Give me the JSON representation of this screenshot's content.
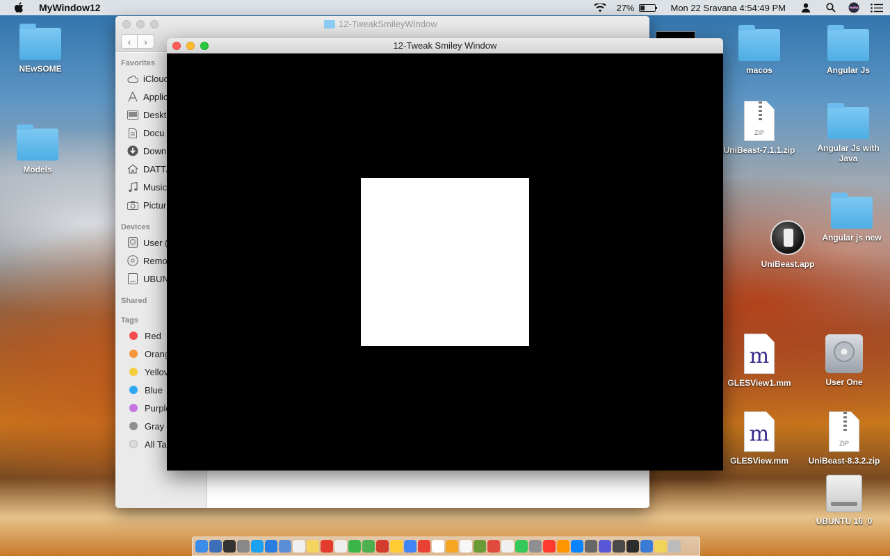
{
  "menubar": {
    "app_name": "MyWindow12",
    "battery_percent": "27%",
    "datetime": "Mon 22 Sravana  4:54:49 PM"
  },
  "desktop": {
    "left_icons": [
      {
        "label": "NEwSOME",
        "kind": "folder"
      },
      {
        "label": "Models",
        "kind": "folder"
      }
    ],
    "right_icons": [
      {
        "label": "macos",
        "kind": "folder"
      },
      {
        "label": "Angular Js",
        "kind": "folder"
      },
      {
        "label": "UniBeast-7.1.1.zip",
        "kind": "zip"
      },
      {
        "label": "Angular Js with Java",
        "kind": "folder"
      },
      {
        "label": "UniBeast.app",
        "kind": "app"
      },
      {
        "label": "Angular js new",
        "kind": "folder"
      },
      {
        "label": "GLESView1.mm",
        "kind": "mm"
      },
      {
        "label": "User One",
        "kind": "drive"
      },
      {
        "label": "GLESView.mm",
        "kind": "mm"
      },
      {
        "label": "UniBeast-8.3.2.zip",
        "kind": "zip"
      },
      {
        "label": "UBUNTU 16_0",
        "kind": "usb"
      }
    ],
    "zip_badge": "ZIP",
    "mm_glyph": "m"
  },
  "finder": {
    "title": "12-TweakSmileyWindow",
    "back": "‹",
    "forward": "›",
    "sections": {
      "favorites": "Favorites",
      "devices": "Devices",
      "shared": "Shared",
      "tags": "Tags"
    },
    "favorites": [
      {
        "label": "iClouc",
        "icon": "cloud-icon"
      },
      {
        "label": "Applic",
        "icon": "applications-icon"
      },
      {
        "label": "Deskt",
        "icon": "desktop-icon"
      },
      {
        "label": "Docu",
        "icon": "document-icon"
      },
      {
        "label": "Down",
        "icon": "download-icon"
      },
      {
        "label": "DATT/",
        "icon": "home-icon"
      },
      {
        "label": "Music",
        "icon": "music-icon"
      },
      {
        "label": "Pictur",
        "icon": "camera-icon"
      }
    ],
    "devices": [
      {
        "label": "User (",
        "icon": "disk-icon"
      },
      {
        "label": "Remo",
        "icon": "optical-disc-icon"
      },
      {
        "label": "UBUN",
        "icon": "usb-drive-icon"
      }
    ],
    "tags": [
      {
        "label": "Red",
        "color": "#f24c4c"
      },
      {
        "label": "Orang",
        "color": "#f7973a"
      },
      {
        "label": "Yellov",
        "color": "#f5ce3e"
      },
      {
        "label": "Blue",
        "color": "#2ea8f0"
      },
      {
        "label": "Purple",
        "color": "#c673e0"
      },
      {
        "label": "Gray",
        "color": "#8e8e8e"
      },
      {
        "label": "All Ta",
        "color": "#dcdcdc"
      }
    ]
  },
  "gl_window": {
    "title": "12-Tweak Smiley Window"
  },
  "dock": {
    "colors": [
      "#3b8be8",
      "#3d6fb8",
      "#333333",
      "#888888",
      "#1da1f2",
      "#2a7de1",
      "#5a8fd8",
      "#f0f0f0",
      "#f4d35e",
      "#e33b2e",
      "#eeeeee",
      "#3bb54a",
      "#4caf50",
      "#d33b2c",
      "#ffcc33",
      "#4285f4",
      "#e94235",
      "#ffffff",
      "#f5a623",
      "#f7f7f7",
      "#6b9b37",
      "#e04a3f",
      "#f0f0f0",
      "#34c759",
      "#8e8e93",
      "#ff3b30",
      "#ff9500",
      "#0a84ff",
      "#666666",
      "#5856d6",
      "#4a4a4a",
      "#2c2c2c",
      "#3a7bd5",
      "#f2d35a",
      "#bbbbbb"
    ]
  }
}
